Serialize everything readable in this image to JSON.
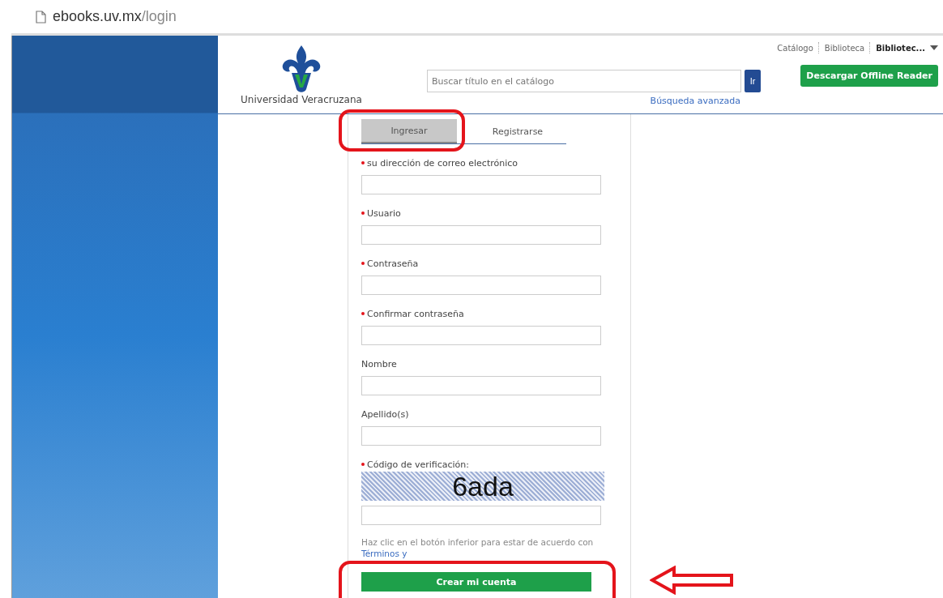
{
  "address_bar": {
    "host": "ebooks.uv.mx",
    "path": "/login"
  },
  "header": {
    "logo_text": "Universidad Veracruzana",
    "top_links": [
      {
        "label": "Catálogo",
        "bold": false
      },
      {
        "label": "Biblioteca",
        "bold": false
      },
      {
        "label": "Bibliotec...",
        "bold": true
      }
    ],
    "search": {
      "placeholder": "Buscar título en el catálogo",
      "button": "Ir"
    },
    "advanced_search": "Búsqueda avanzada",
    "download_button": "Descargar Offline Reader"
  },
  "tabs": [
    {
      "label": "Ingresar",
      "selected": true
    },
    {
      "label": "Registrarse",
      "selected": false
    }
  ],
  "fields": [
    {
      "kind": "input",
      "label": "su dirección de correo electrónico",
      "required": true
    },
    {
      "kind": "input",
      "label": "Usuario",
      "required": true
    },
    {
      "kind": "input",
      "label": "Contraseña",
      "required": true
    },
    {
      "kind": "input",
      "label": "Confirmar contraseña",
      "required": true
    },
    {
      "kind": "input",
      "label": "Nombre",
      "required": false
    },
    {
      "kind": "input",
      "label": "Apellido(s)",
      "required": false
    },
    {
      "kind": "captcha",
      "label": "Código de verificación:",
      "required": true,
      "captcha_text": "6ada"
    }
  ],
  "terms": {
    "text": "Haz clic en el botón inferior para estar de acuerdo con ",
    "link": "Términos y"
  },
  "submit_button": "Crear mi cuenta",
  "annotations": [
    {
      "kind": "oval"
    },
    {
      "kind": "oval"
    },
    {
      "kind": "arrow"
    }
  ]
}
